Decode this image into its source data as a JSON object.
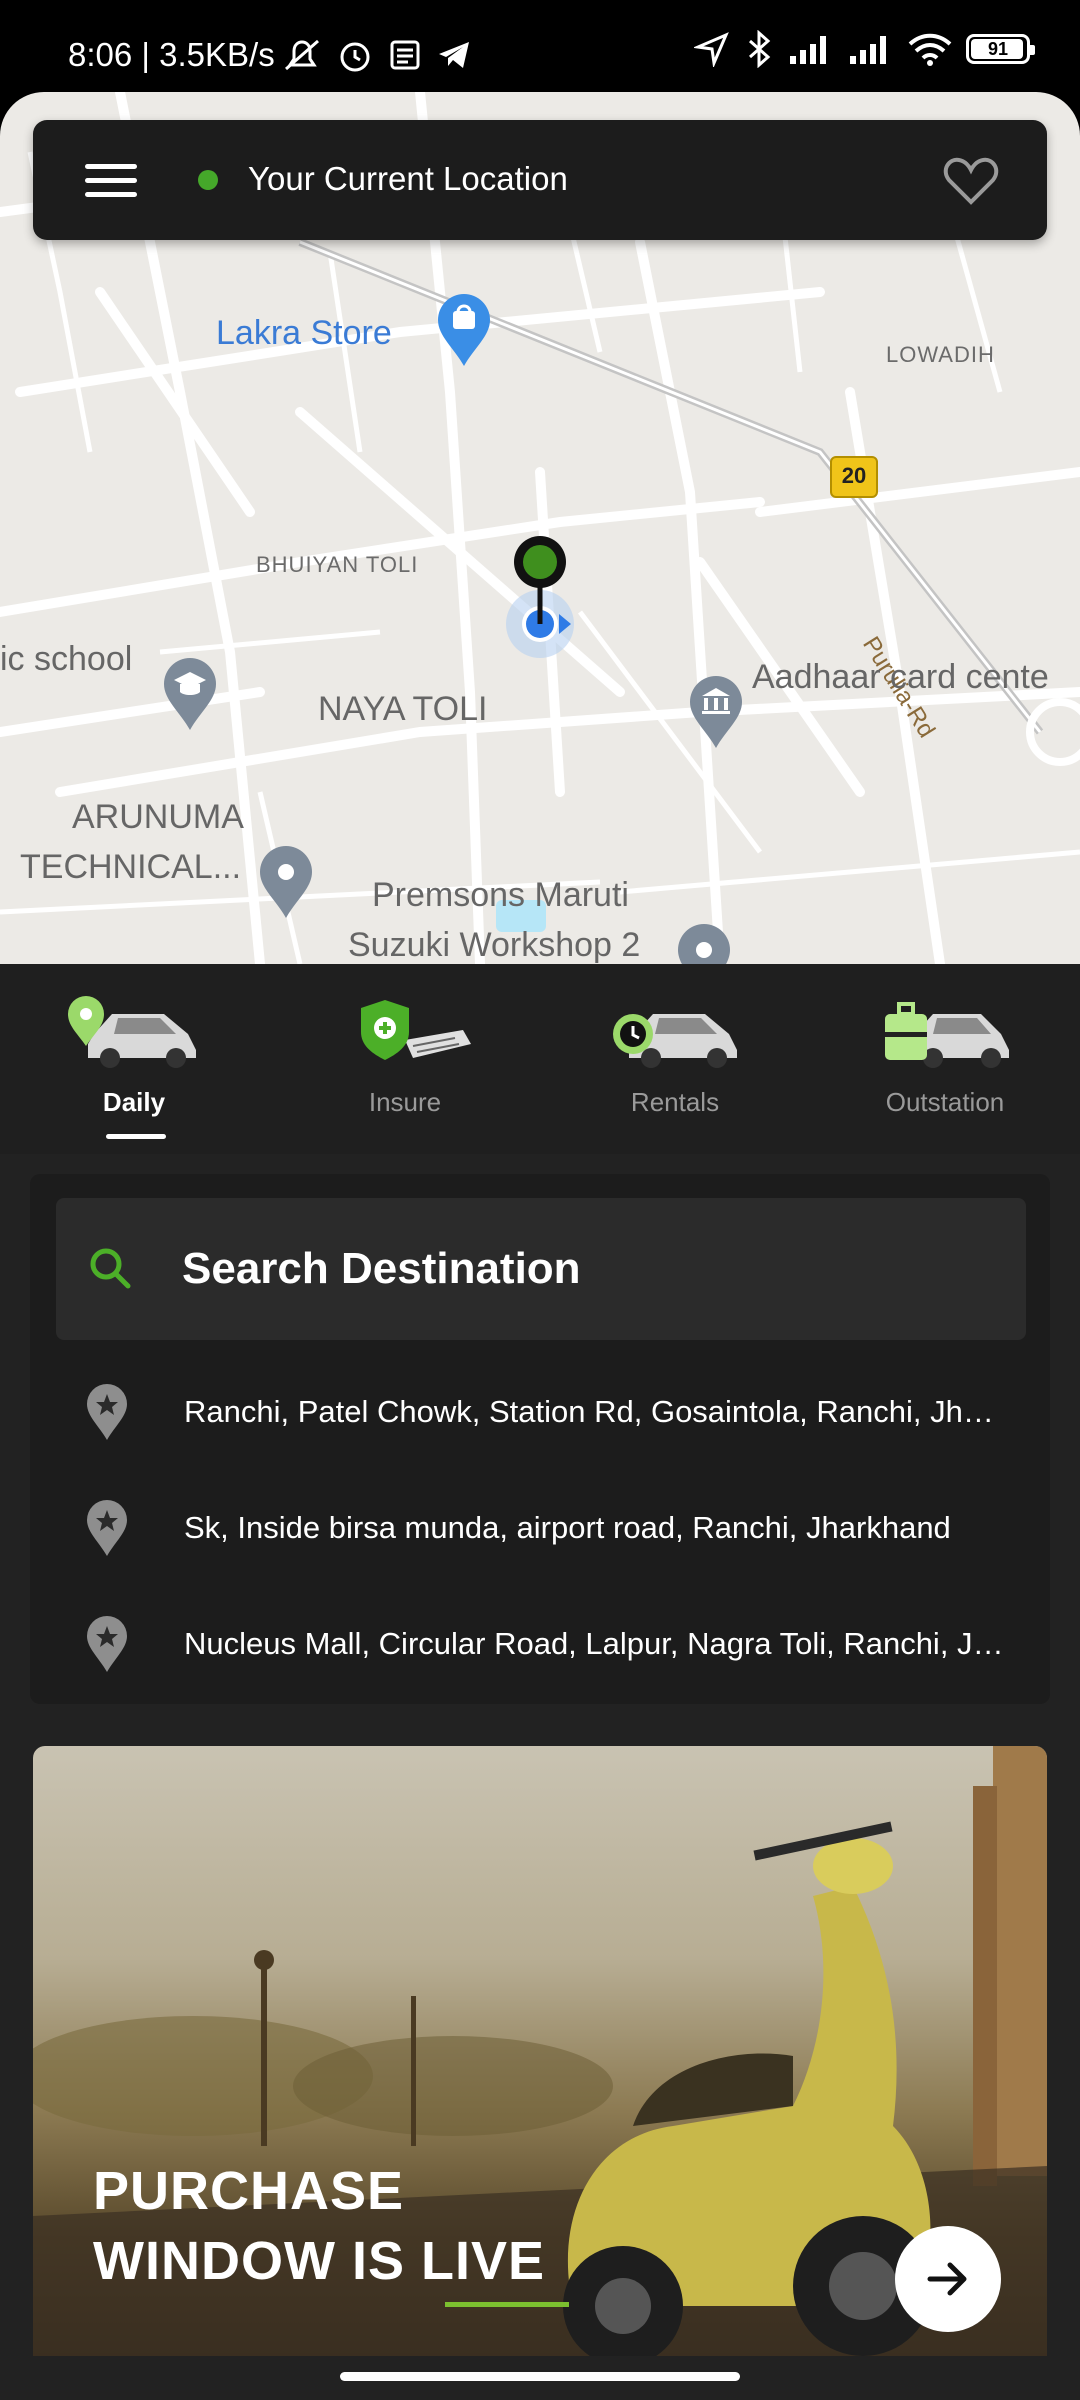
{
  "status_bar": {
    "time_speed": "8:06 | 3.5KB/s",
    "battery": "91"
  },
  "top_bar": {
    "location_label": "Your Current Location"
  },
  "map": {
    "labels": {
      "lakra_store": "Lakra Store",
      "lowadih": "LOWADIH",
      "road_badge": "20",
      "purulia_rd": "Purulia-Rd",
      "bhuiyan_toli": "BHUIYAN TOLI",
      "school": "ic school",
      "naya_toli": "NAYA TOLI",
      "aadhaar": "Aadhaar card cente",
      "arunuma_1": "ARUNUMA",
      "arunuma_2": "TECHNICAL...",
      "premsons_1": "Premsons Maruti",
      "premsons_2": "Suzuki Workshop 2"
    }
  },
  "tabs": [
    {
      "label": "Daily",
      "active": true,
      "icon": "car-location-icon"
    },
    {
      "label": "Insure",
      "active": false,
      "icon": "shield-plus-icon"
    },
    {
      "label": "Rentals",
      "active": false,
      "icon": "car-clock-icon"
    },
    {
      "label": "Outstation",
      "active": false,
      "icon": "car-luggage-icon"
    }
  ],
  "search": {
    "placeholder": "Search Destination"
  },
  "recent_places": [
    "Ranchi, Patel Chowk, Station Rd, Gosaintola, Ranchi, Jharkhand",
    "Sk, Inside birsa munda, airport road, Ranchi, Jharkhand",
    "Nucleus Mall, Circular Road, Lalpur, Nagra Toli, Ranchi, Jharkhand"
  ],
  "banner": {
    "line1": "PURCHASE",
    "line2_prefix": "WINDOW IS ",
    "line2_highlight": "LIVE"
  },
  "colors": {
    "accent_green": "#45a82a",
    "sheet_bg": "#222222",
    "map_bg": "#eceae6"
  }
}
